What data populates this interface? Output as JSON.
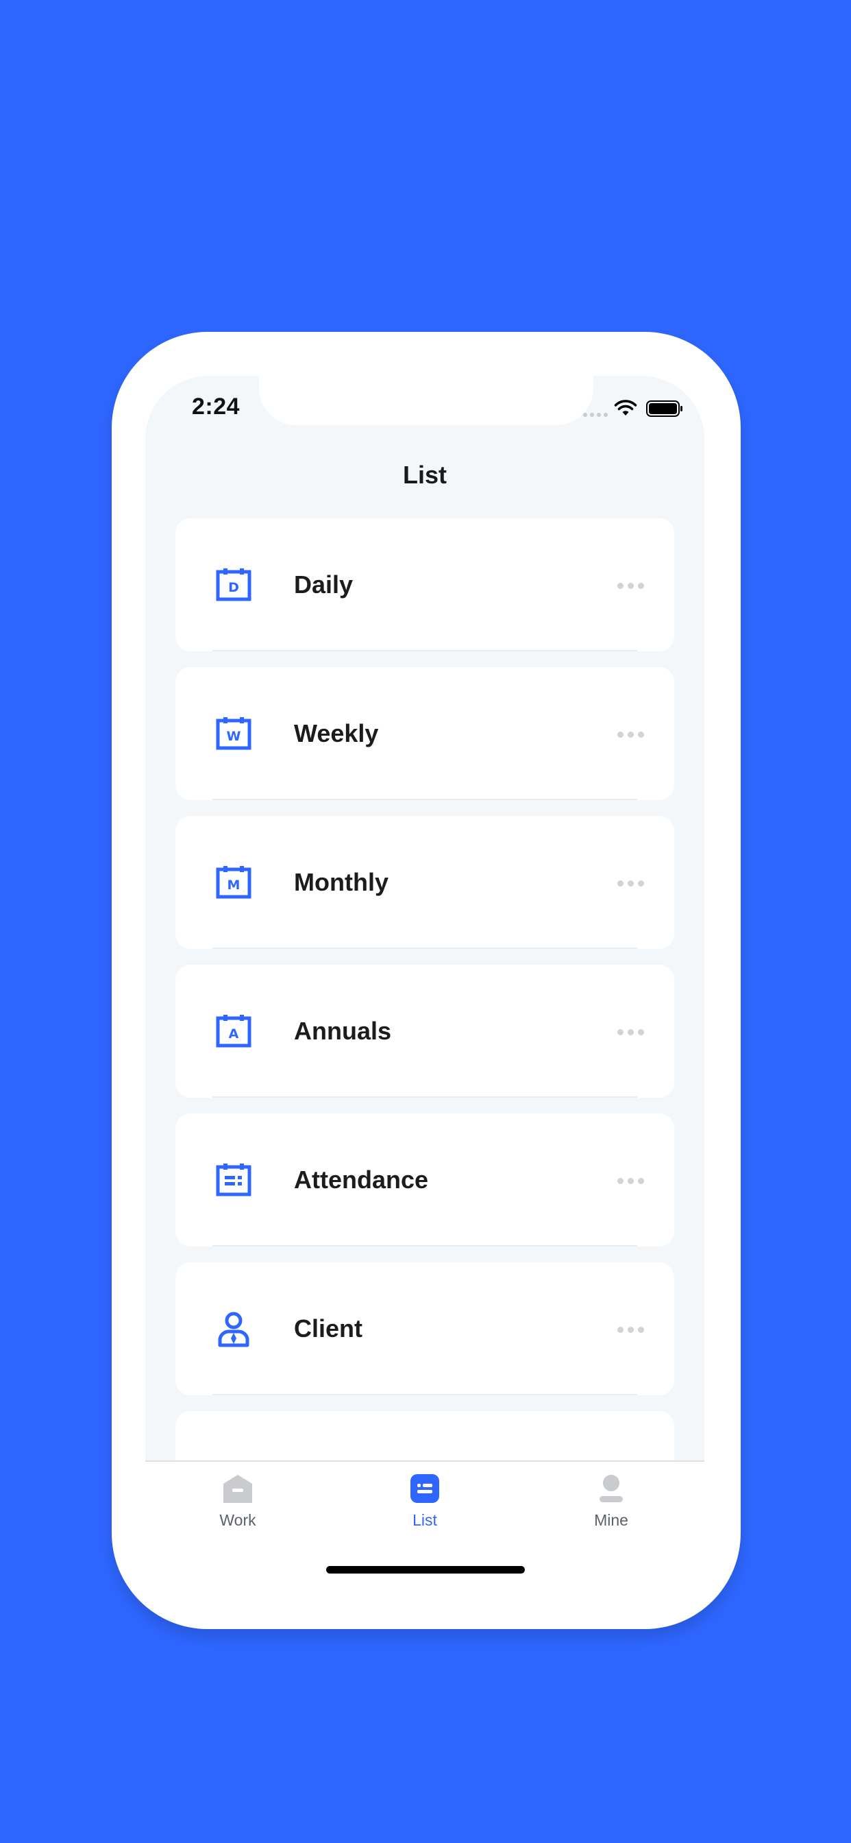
{
  "status_bar": {
    "time": "2:24"
  },
  "header": {
    "title": "List"
  },
  "list": {
    "items": [
      {
        "label": "Daily",
        "icon": "calendar-d-icon",
        "letter": "D"
      },
      {
        "label": "Weekly",
        "icon": "calendar-w-icon",
        "letter": "W"
      },
      {
        "label": "Monthly",
        "icon": "calendar-m-icon",
        "letter": "M"
      },
      {
        "label": "Annuals",
        "icon": "calendar-a-icon",
        "letter": "A"
      },
      {
        "label": "Attendance",
        "icon": "attendance-calendar-icon"
      },
      {
        "label": "Client",
        "icon": "client-person-icon"
      }
    ]
  },
  "tabbar": {
    "tabs": [
      {
        "label": "Work",
        "icon": "home-icon",
        "active": false
      },
      {
        "label": "List",
        "icon": "list-icon",
        "active": true
      },
      {
        "label": "Mine",
        "icon": "person-icon",
        "active": false
      }
    ]
  },
  "colors": {
    "background": "#2e66ff",
    "accent": "#2e66ff",
    "text": "#1c1c1e",
    "inactive_tab": "#c9cbcf",
    "screen_bg": "#f4f7fa"
  }
}
